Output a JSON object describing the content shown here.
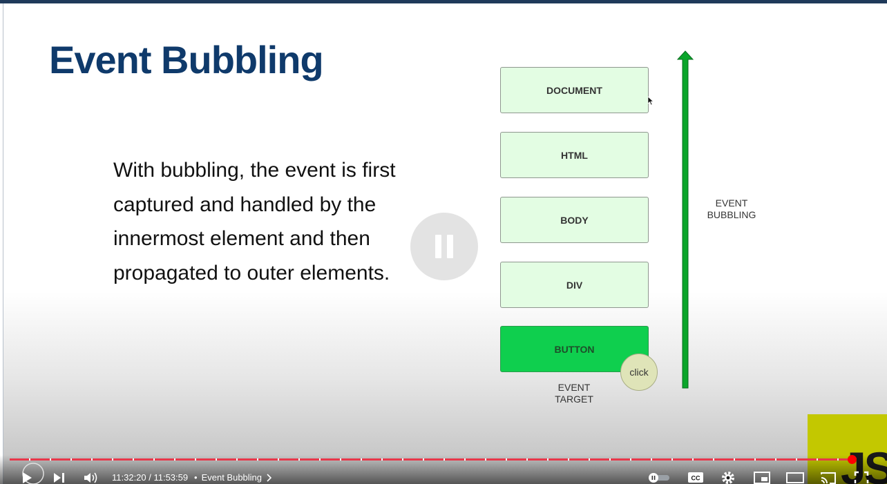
{
  "slide": {
    "title": "Event Bubbling",
    "body": "With bubbling, the event is first captured and handled by the innermost element and then propagated to outer elements."
  },
  "diagram": {
    "boxes": [
      "DOCUMENT",
      "HTML",
      "BODY",
      "DIV",
      "BUTTON"
    ],
    "click_label": "click",
    "target_label_line1": "EVENT",
    "target_label_line2": "TARGET",
    "bubbling_label_line1": "EVENT",
    "bubbling_label_line2": "BUBBLING",
    "colors": {
      "box": "#e3fde3",
      "target": "#0fcf4e",
      "arrow": "#0aa52a"
    }
  },
  "player": {
    "time": "11:32:20 / 11:53:59",
    "chapter_separator": "•",
    "chapter": "Event Bubbling",
    "progress_fraction": 0.968,
    "controls": [
      "play-icon",
      "next-icon",
      "volume-icon",
      "autoplay-toggle",
      "cc-icon",
      "settings-icon",
      "miniplayer-icon",
      "theater-icon",
      "cast-icon",
      "fullscreen-icon"
    ]
  },
  "logo": {
    "text": "JS"
  },
  "colors": {
    "title": "#0f3a6b",
    "progress": "#e8374a"
  }
}
